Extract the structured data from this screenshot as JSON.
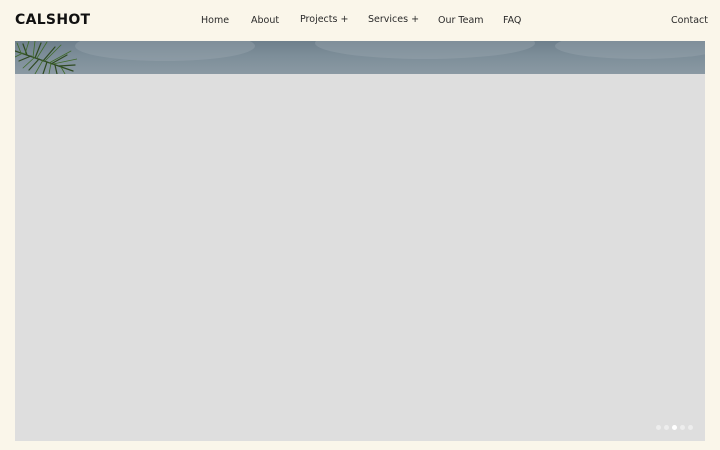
{
  "brand": {
    "logo_text": "CALSHOT"
  },
  "nav": {
    "home": "Home",
    "about": "About",
    "projects": "Projects +",
    "services": "Services +",
    "our_team": "Our Team",
    "faq": "FAQ",
    "contact": "Contact"
  },
  "slider": {
    "slide_count": 5,
    "active_slide": 3
  },
  "colors": {
    "page_background": "#faf6ea",
    "slide_placeholder": "#dedede",
    "sky": "#7d8e99",
    "logo": "#111111",
    "nav_text": "#2a2a2a"
  }
}
